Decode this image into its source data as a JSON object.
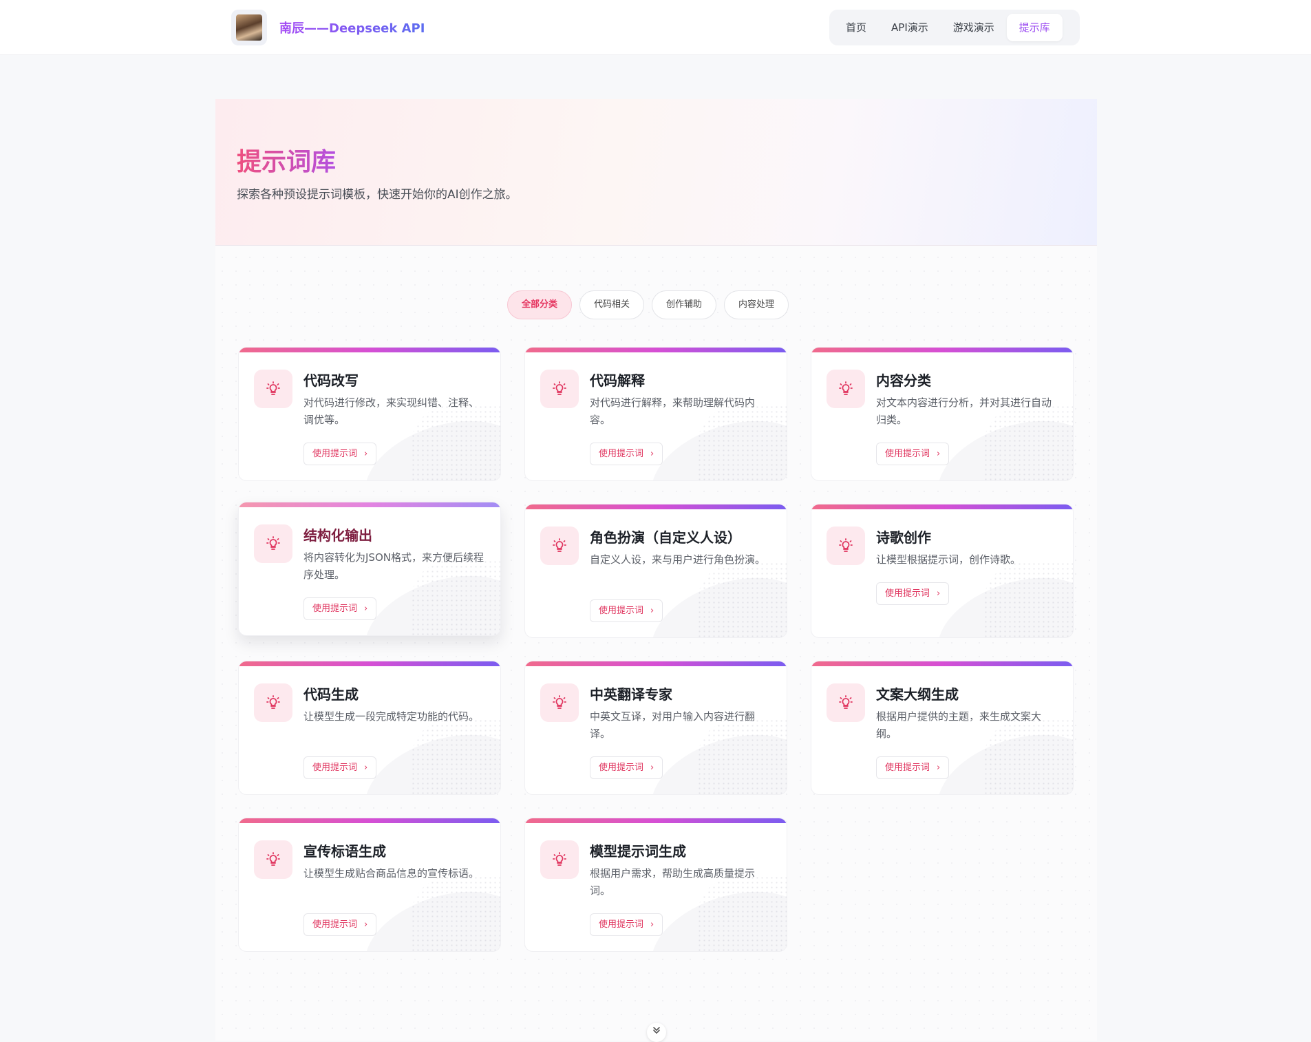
{
  "header": {
    "brand_name": "南辰——Deepseek API",
    "nav": [
      {
        "label": "首页"
      },
      {
        "label": "API演示"
      },
      {
        "label": "游戏演示"
      },
      {
        "label": "提示库",
        "active": true
      }
    ]
  },
  "hero": {
    "title": "提示词库",
    "subtitle": "探索各种预设提示词模板，快速开始你的AI创作之旅。"
  },
  "filters": [
    {
      "label": "全部分类",
      "active": true
    },
    {
      "label": "代码相关"
    },
    {
      "label": "创作辅助"
    },
    {
      "label": "内容处理"
    }
  ],
  "cards": [
    {
      "title": "代码改写",
      "desc": "对代码进行修改，来实现纠错、注释、调优等。",
      "button": "使用提示词",
      "icon": "lightbulb-icon"
    },
    {
      "title": "代码解释",
      "desc": "对代码进行解释，来帮助理解代码内容。",
      "button": "使用提示词",
      "icon": "lightbulb-icon"
    },
    {
      "title": "内容分类",
      "desc": "对文本内容进行分析，并对其进行自动归类。",
      "button": "使用提示词",
      "icon": "lightbulb-icon"
    },
    {
      "title": "结构化输出",
      "desc": "将内容转化为JSON格式，来方便后续程序处理。",
      "button": "使用提示词",
      "icon": "lightbulb-icon"
    },
    {
      "title": "角色扮演（自定义人设）",
      "desc": "自定义人设，来与用户进行角色扮演。",
      "button": "使用提示词",
      "icon": "lightbulb-icon"
    },
    {
      "title": "诗歌创作",
      "desc": "让模型根据提示词，创作诗歌。",
      "button": "使用提示词",
      "icon": "lightbulb-icon"
    },
    {
      "title": "代码生成",
      "desc": "让模型生成一段完成特定功能的代码。",
      "button": "使用提示词",
      "icon": "lightbulb-icon"
    },
    {
      "title": "中英翻译专家",
      "desc": "中英文互译，对用户输入内容进行翻译。",
      "button": "使用提示词",
      "icon": "lightbulb-icon"
    },
    {
      "title": "文案大纲生成",
      "desc": "根据用户提供的主题，来生成文案大纲。",
      "button": "使用提示词",
      "icon": "lightbulb-icon"
    },
    {
      "title": "宣传标语生成",
      "desc": "让模型生成贴合商品信息的宣传标语。",
      "button": "使用提示词",
      "icon": "lightbulb-icon"
    },
    {
      "title": "模型提示词生成",
      "desc": "根据用户需求，帮助生成高质量提示词。",
      "button": "使用提示词",
      "icon": "lightbulb-icon"
    }
  ],
  "colors": {
    "accent_pink": "#e5345f",
    "accent_purple": "#9b4cf1",
    "card_bar_start": "#f06a8c",
    "card_bar_end": "#7b5cf0"
  }
}
